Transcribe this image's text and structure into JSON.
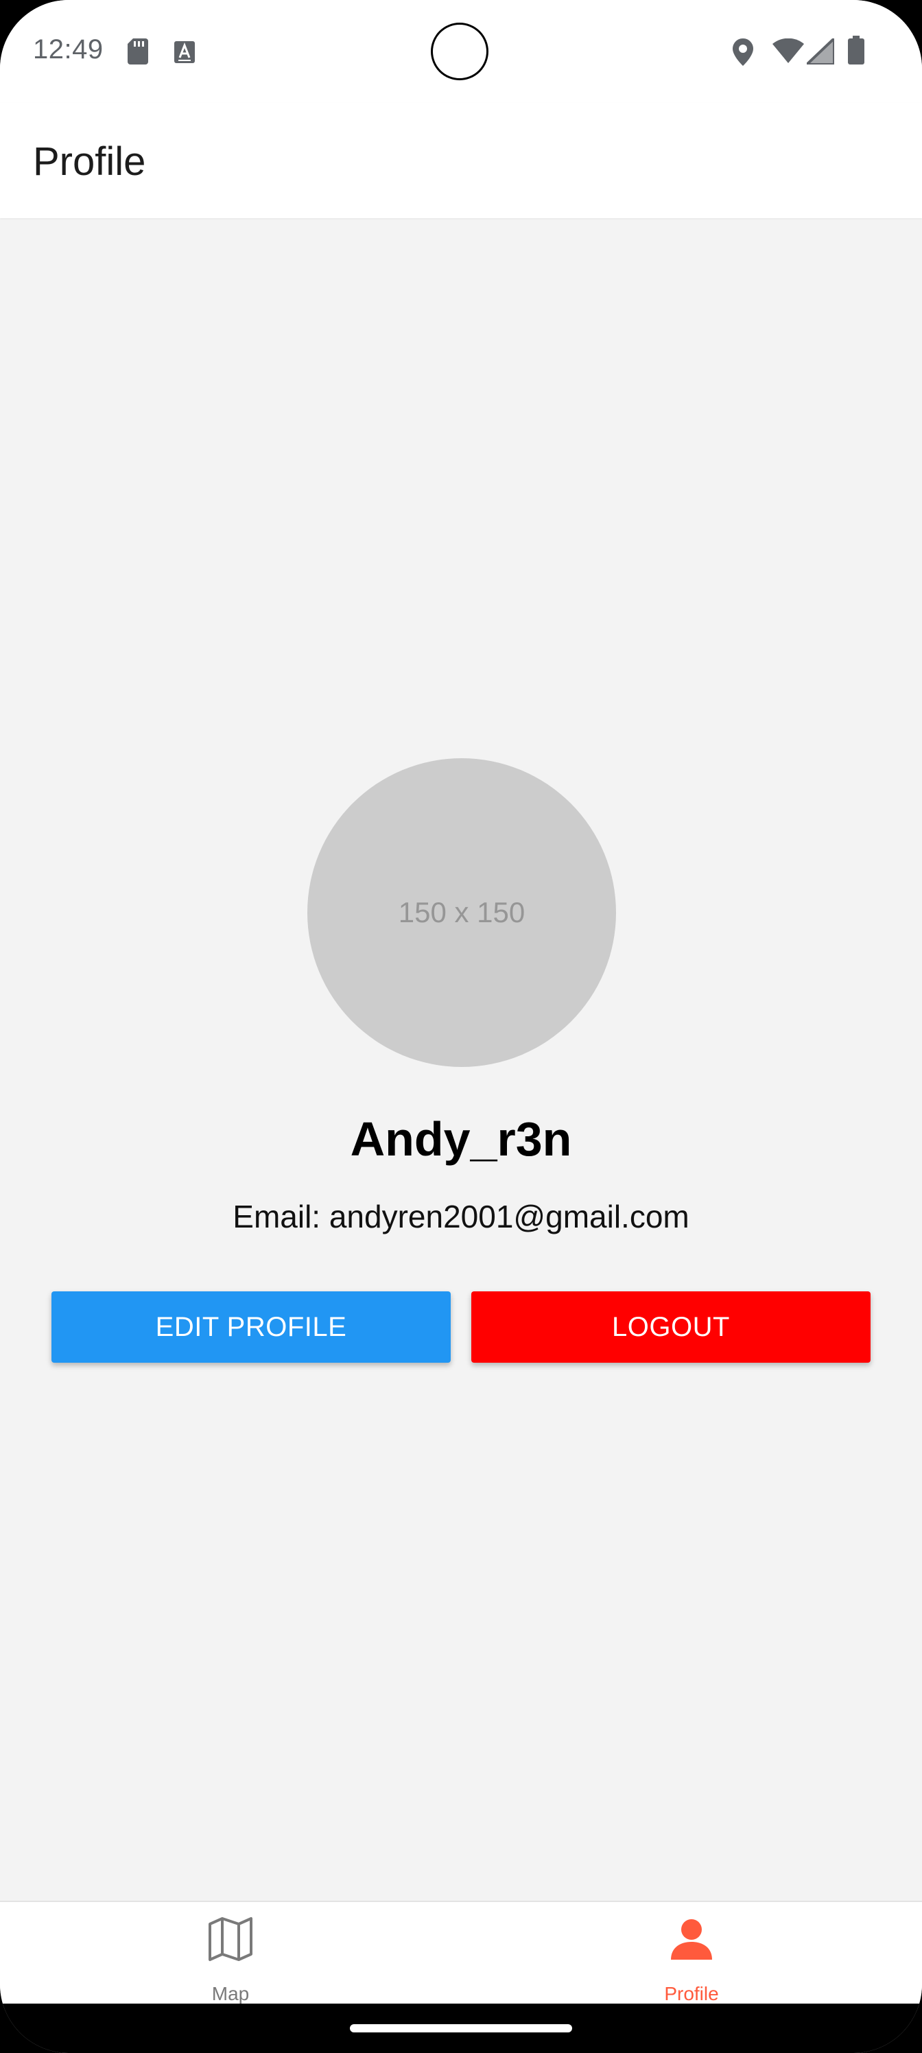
{
  "status_bar": {
    "time": "12:49",
    "left_icons": [
      "sd-card-icon",
      "keyboard-a-icon"
    ],
    "right_icons": [
      "location-icon",
      "wifi-icon",
      "signal-icon",
      "battery-icon"
    ]
  },
  "header": {
    "title": "Profile"
  },
  "profile": {
    "avatar_placeholder": "150 x 150",
    "username": "Andy_r3n",
    "email_line": "Email: andyren2001@gmail.com"
  },
  "actions": {
    "edit_label": "EDIT PROFILE",
    "logout_label": "LOGOUT"
  },
  "tabs": [
    {
      "label": "Map",
      "icon": "map-icon",
      "active": false
    },
    {
      "label": "Profile",
      "icon": "person-icon",
      "active": true
    }
  ],
  "colors": {
    "edit_button": "#2196f3",
    "logout_button": "#ff0000",
    "active_tab": "#ff5a3c",
    "inactive_tab": "#7a7a7a",
    "background": "#f3f3f3"
  }
}
